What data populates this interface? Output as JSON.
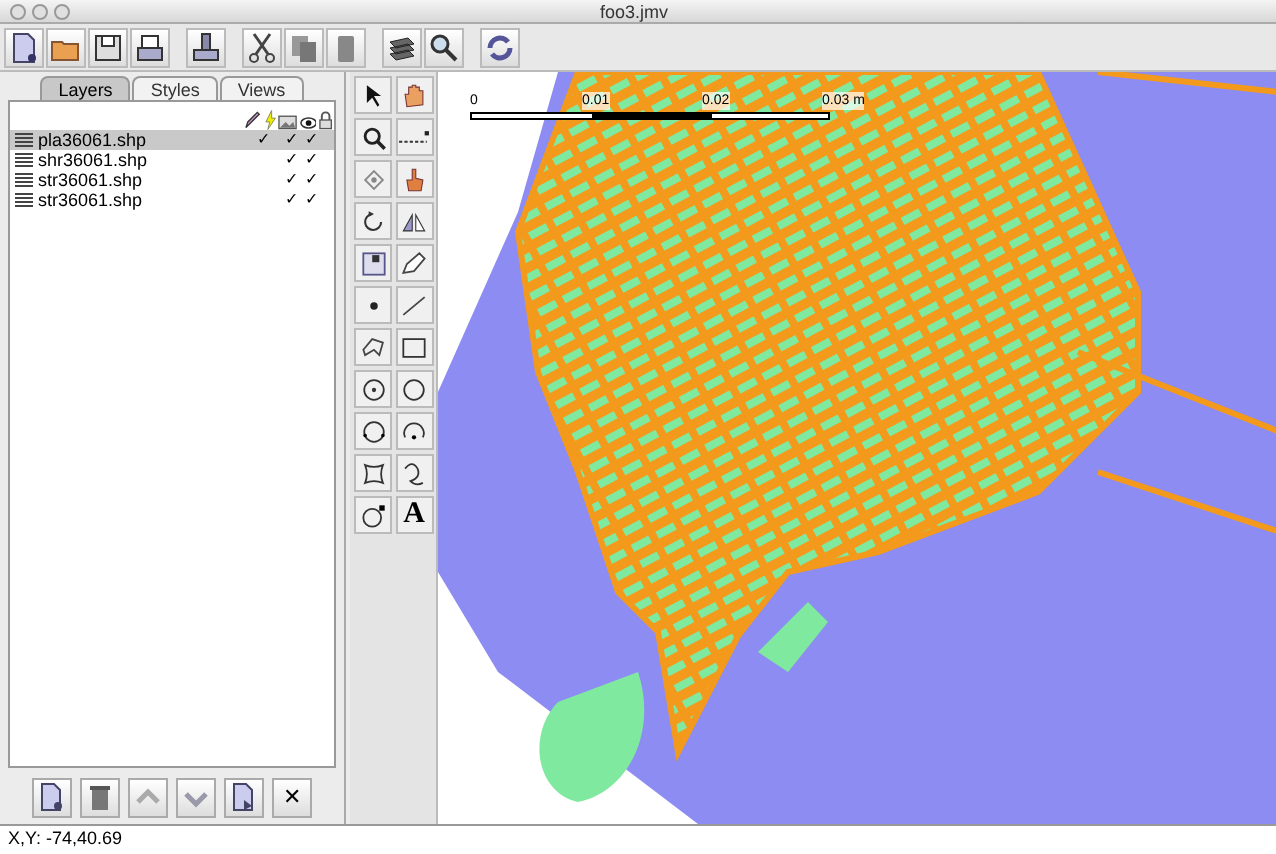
{
  "window": {
    "title": "foo3.jmv"
  },
  "tabs": [
    {
      "label": "Layers",
      "selected": true
    },
    {
      "label": "Styles",
      "selected": false
    },
    {
      "label": "Views",
      "selected": false
    }
  ],
  "layers": [
    {
      "name": "pla36061.shp",
      "selected": true,
      "editable": true,
      "picture_column": true,
      "visible": true
    },
    {
      "name": "shr36061.shp",
      "selected": false,
      "editable": false,
      "picture_column": true,
      "visible": true
    },
    {
      "name": "str36061.shp",
      "selected": false,
      "editable": false,
      "picture_column": true,
      "visible": true
    },
    {
      "name": "str36061.shp",
      "selected": false,
      "editable": false,
      "picture_column": true,
      "visible": true
    }
  ],
  "check_mark": "✓",
  "layer_buttons": [
    {
      "kind": "add"
    },
    {
      "kind": "trash"
    },
    {
      "kind": "up"
    },
    {
      "kind": "down"
    },
    {
      "kind": "import"
    },
    {
      "kind": "close",
      "glyph": "✕"
    }
  ],
  "text_tool_glyph": "A",
  "scale_bar": {
    "labels": [
      "0",
      "0.01",
      "0.02",
      "0.03 m"
    ]
  },
  "status_bar": {
    "text": "X,Y: -74,40.69"
  }
}
